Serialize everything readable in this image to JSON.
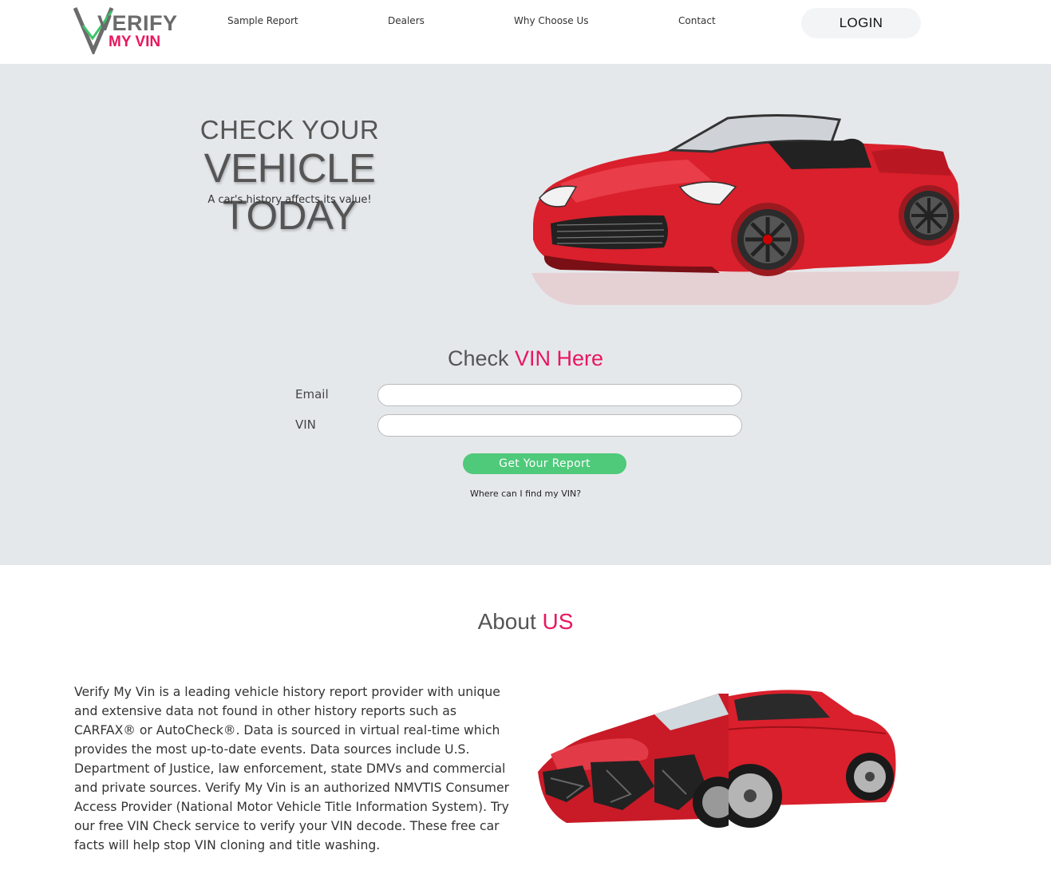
{
  "logo": {
    "top": "VERIFY",
    "bottom": "MY VIN"
  },
  "nav": {
    "sample_report": "Sample Report",
    "dealers": "Dealers",
    "why_choose": "Why Choose Us",
    "contact": "Contact",
    "login": "LOGIN"
  },
  "hero": {
    "line1": "CHECK YOUR",
    "line2": "VEHICLE TODAY",
    "subtitle": "A car's history affects its value!"
  },
  "vin_form": {
    "title_part1": "Check",
    "title_part2": "VIN Here",
    "email_label": "Email",
    "email_value": "",
    "vin_label": "VIN",
    "vin_value": "",
    "submit_label": "Get Your Report",
    "help_link": "Where can I find my VIN?"
  },
  "about": {
    "title_part1": "About",
    "title_part2": "US",
    "body": "Verify My Vin is a leading vehicle history report provider with unique and extensive data not found in other history reports such as CARFAX® or AutoCheck®. Data is sourced in virtual real-time which provides the most up-to-date events. Data sources include U.S. Department of Justice, law enforcement, state DMVs and commercial and private sources. Verify My Vin is an authorized NMVTIS Consumer Access Provider (National Motor Vehicle Title Information System). Try our free VIN Check service to verify your VIN decode. These free car facts will help stop VIN cloning and title washing."
  },
  "colors": {
    "accent": "#e8175d",
    "button_green": "#4fc97a",
    "hero_bg": "#e5e8eb",
    "car_red": "#d9202c"
  }
}
